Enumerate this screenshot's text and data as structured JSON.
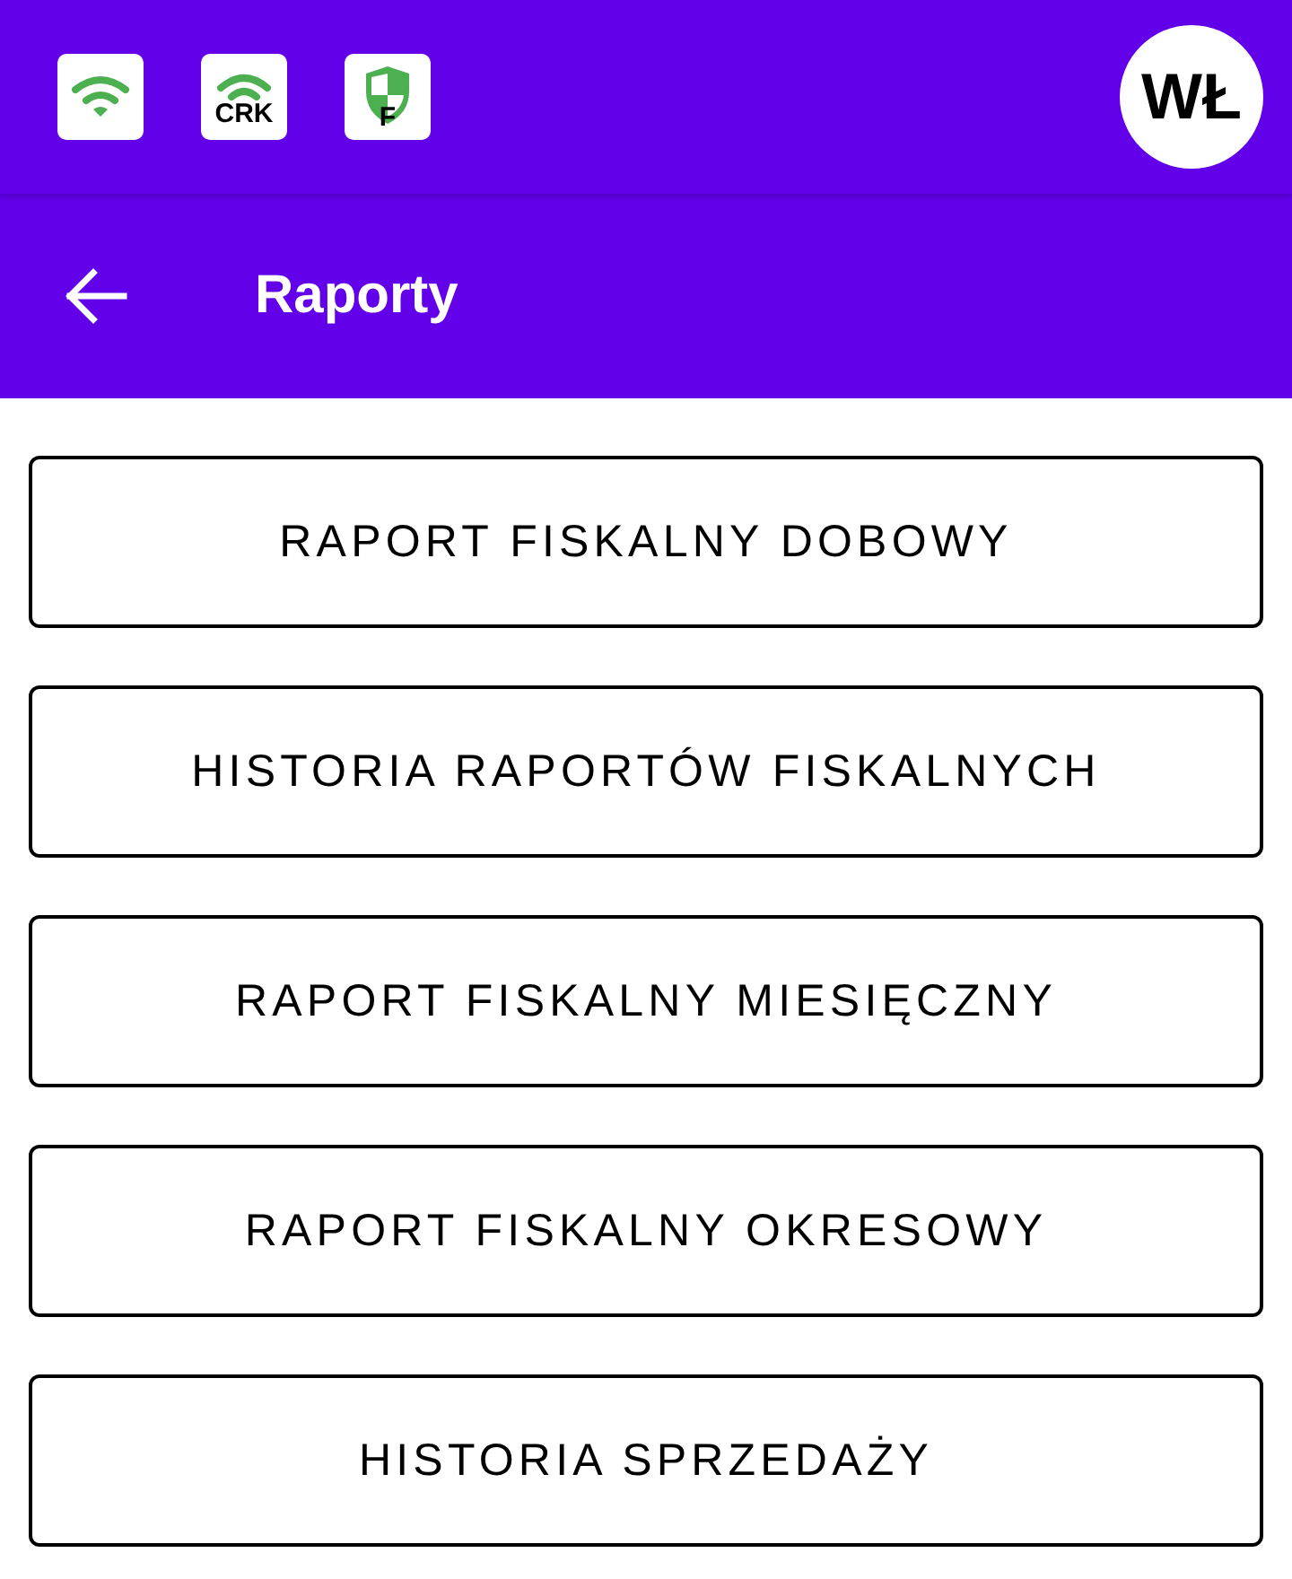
{
  "status_bar": {
    "icons": [
      {
        "kind": "wifi"
      },
      {
        "kind": "wifi",
        "label": "CRK"
      },
      {
        "kind": "shield",
        "label": "F"
      }
    ],
    "avatar": "WŁ"
  },
  "app_bar": {
    "title": "Raporty"
  },
  "buttons": [
    "RAPORT FISKALNY DOBOWY",
    "HISTORIA RAPORTÓW FISKALNYCH",
    "RAPORT FISKALNY MIESIĘCZNY",
    "RAPORT FISKALNY OKRESOWY",
    "HISTORIA SPRZEDAŻY"
  ]
}
